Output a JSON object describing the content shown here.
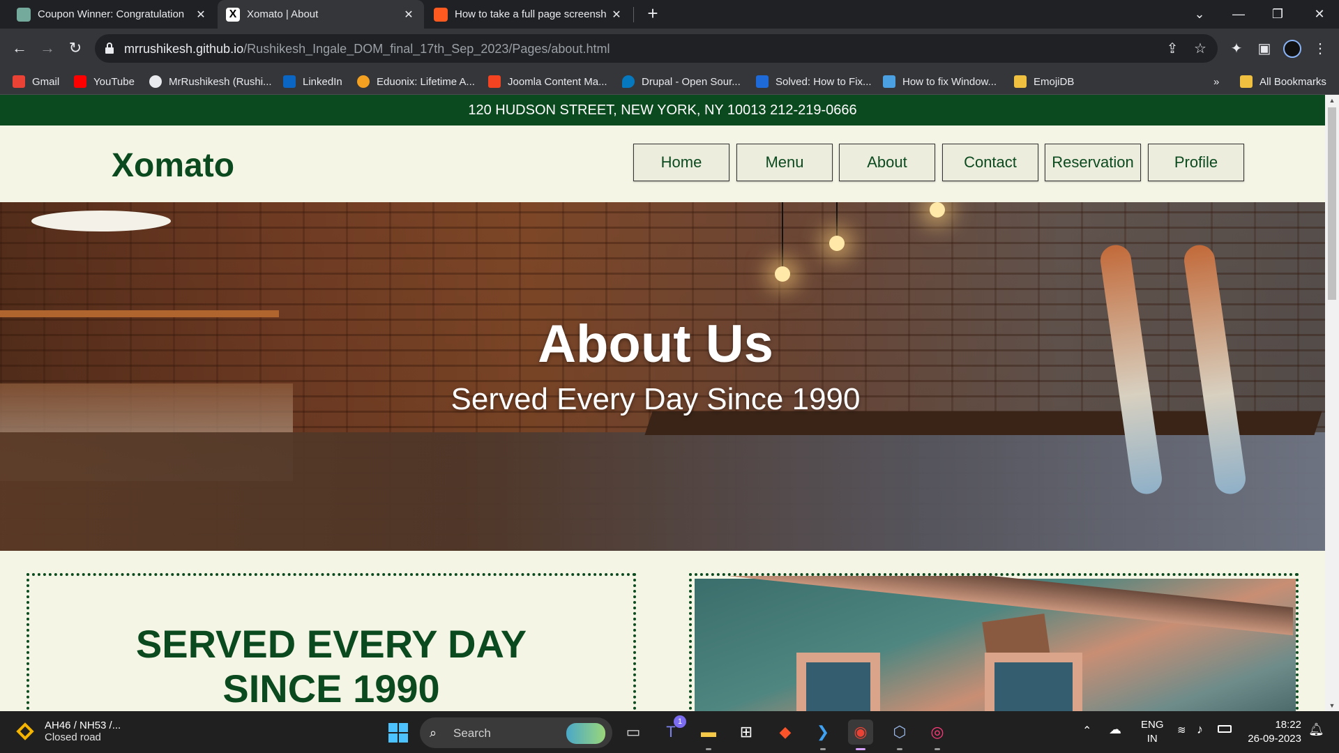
{
  "browser": {
    "tabs": [
      {
        "title": "Coupon Winner: Congratulation",
        "close": "✕"
      },
      {
        "title": "Xomato | About",
        "close": "✕"
      },
      {
        "title": "How to take a full page screensh",
        "close": "✕"
      }
    ],
    "new_tab": "+",
    "url_host": "mrrushikesh.github.io",
    "url_path": "/Rushikesh_Ingale_DOM_final_17th_Sep_2023/Pages/about.html",
    "bookmarks": [
      {
        "label": "Gmail",
        "color": "#ea4335"
      },
      {
        "label": "YouTube",
        "color": "#ff0000"
      },
      {
        "label": "MrRushikesh (Rushi...",
        "color": "#e8eaed"
      },
      {
        "label": "LinkedIn",
        "color": "#0a66c2"
      },
      {
        "label": "Eduonix: Lifetime A...",
        "color": "#f4a020"
      },
      {
        "label": "Joomla Content Ma...",
        "color": "#f44321"
      },
      {
        "label": "Drupal - Open Sour...",
        "color": "#0678be"
      },
      {
        "label": "Solved: How to Fix...",
        "color": "#1e6ad8"
      },
      {
        "label": "How to fix Window...",
        "color": "#4aa0e0"
      },
      {
        "label": "EmojiDB",
        "color": "#f0c040"
      }
    ],
    "bookmarks_more": "»",
    "all_bookmarks": "All Bookmarks"
  },
  "site": {
    "address_strip": "120 HUDSON STREET, NEW YORK, NY 10013 212-219-0666",
    "logo": "Xomato",
    "nav": [
      "Home",
      "Menu",
      "About",
      "Contact",
      "Reservation",
      "Profile"
    ],
    "hero_title": "About Us",
    "hero_subtitle": "Served Every Day Since 1990",
    "section_heading_line1": "SERVED EVERY DAY",
    "section_heading_line2": "SINCE 1990",
    "colors": {
      "brand_green": "#0b4a1e",
      "page_bg": "#f5f5e6"
    }
  },
  "taskbar": {
    "weather_line1": "AH46 / NH53 /...",
    "weather_line2": "Closed road",
    "search_label": "Search",
    "teams_badge": "1",
    "lang_line1": "ENG",
    "lang_line2": "IN",
    "time": "18:22",
    "date": "26-09-2023"
  }
}
